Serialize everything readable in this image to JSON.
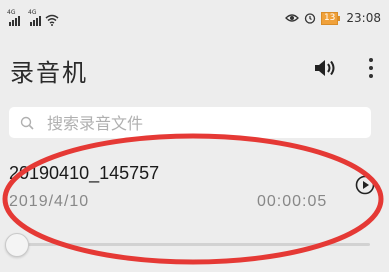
{
  "status_bar": {
    "sim1_tag": "4G",
    "sim2_tag": "4G",
    "battery_level": "13",
    "time": "23:08"
  },
  "app": {
    "title": "录音机"
  },
  "search": {
    "placeholder": "搜索录音文件",
    "value": ""
  },
  "recordings": [
    {
      "name": "20190410_145757",
      "date": "2019/4/10",
      "duration": "00:00:05"
    }
  ],
  "player": {
    "progress": 0
  },
  "colors": {
    "background": "#ededed",
    "annotation_ring": "#e53935",
    "battery": "#f0a13a"
  },
  "icons": [
    "signal-icon",
    "wifi-icon",
    "eye-icon",
    "alarm-icon",
    "battery-icon",
    "speaker-icon",
    "more-icon",
    "search-icon",
    "play-icon"
  ]
}
